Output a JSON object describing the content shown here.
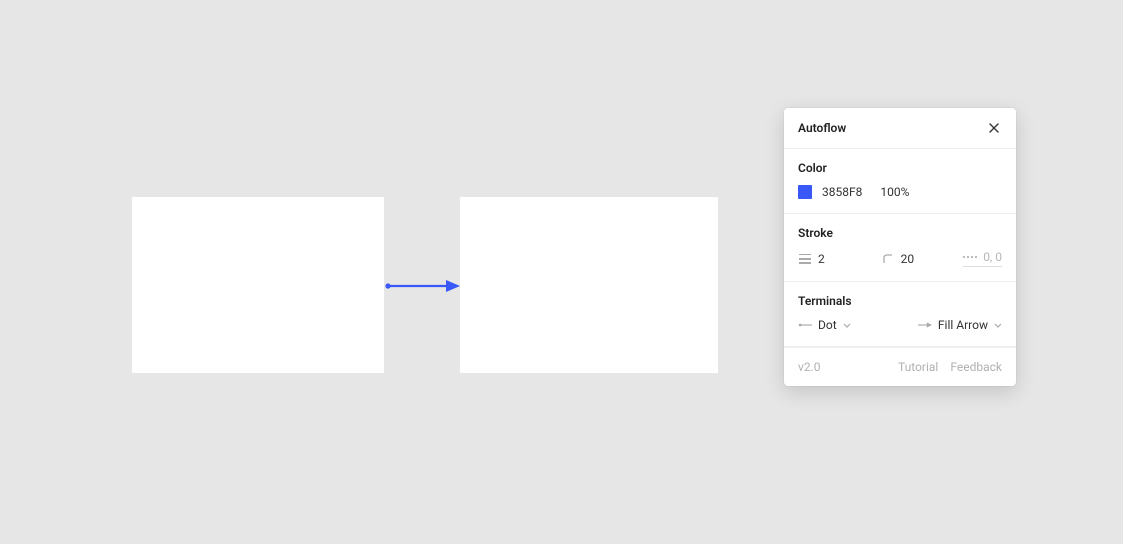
{
  "panel": {
    "title": "Autoflow",
    "color": {
      "section_label": "Color",
      "hex": "3858F8",
      "opacity": "100%",
      "swatch_hex": "#3858F8"
    },
    "stroke": {
      "section_label": "Stroke",
      "weight": "2",
      "corner": "20",
      "dash": "0, 0"
    },
    "terminals": {
      "section_label": "Terminals",
      "start": "Dot",
      "end": "Fill Arrow"
    },
    "footer": {
      "version": "v2.0",
      "tutorial": "Tutorial",
      "feedback": "Feedback"
    }
  },
  "connector": {
    "stroke": "#3858F8",
    "weight": 2,
    "start_cap": "Dot",
    "end_cap": "Fill Arrow"
  }
}
